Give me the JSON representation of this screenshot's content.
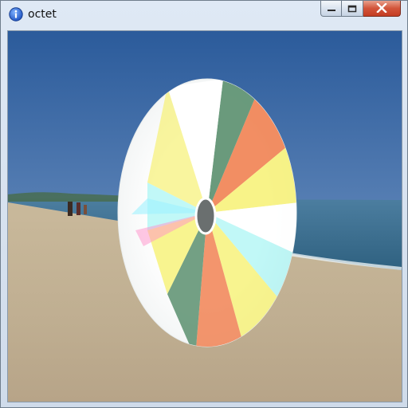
{
  "window": {
    "title": "octet",
    "app_icon": "info-icon",
    "controls": [
      "minimize-icon",
      "maximize-icon",
      "close-icon"
    ]
  },
  "scene": {
    "description_icons": [
      "beach-background",
      "rainbow-disc"
    ],
    "colors": {
      "sky_top": "#2f5f9e",
      "sky_bottom": "#a9c2da",
      "sea": "#3d6f8c",
      "sand": "#c6b79b",
      "disc_green": "#5a8f6e",
      "disc_orange": "#f07a48",
      "disc_yellow": "#f6f06a",
      "disc_cyan": "#8ef3f0"
    }
  }
}
